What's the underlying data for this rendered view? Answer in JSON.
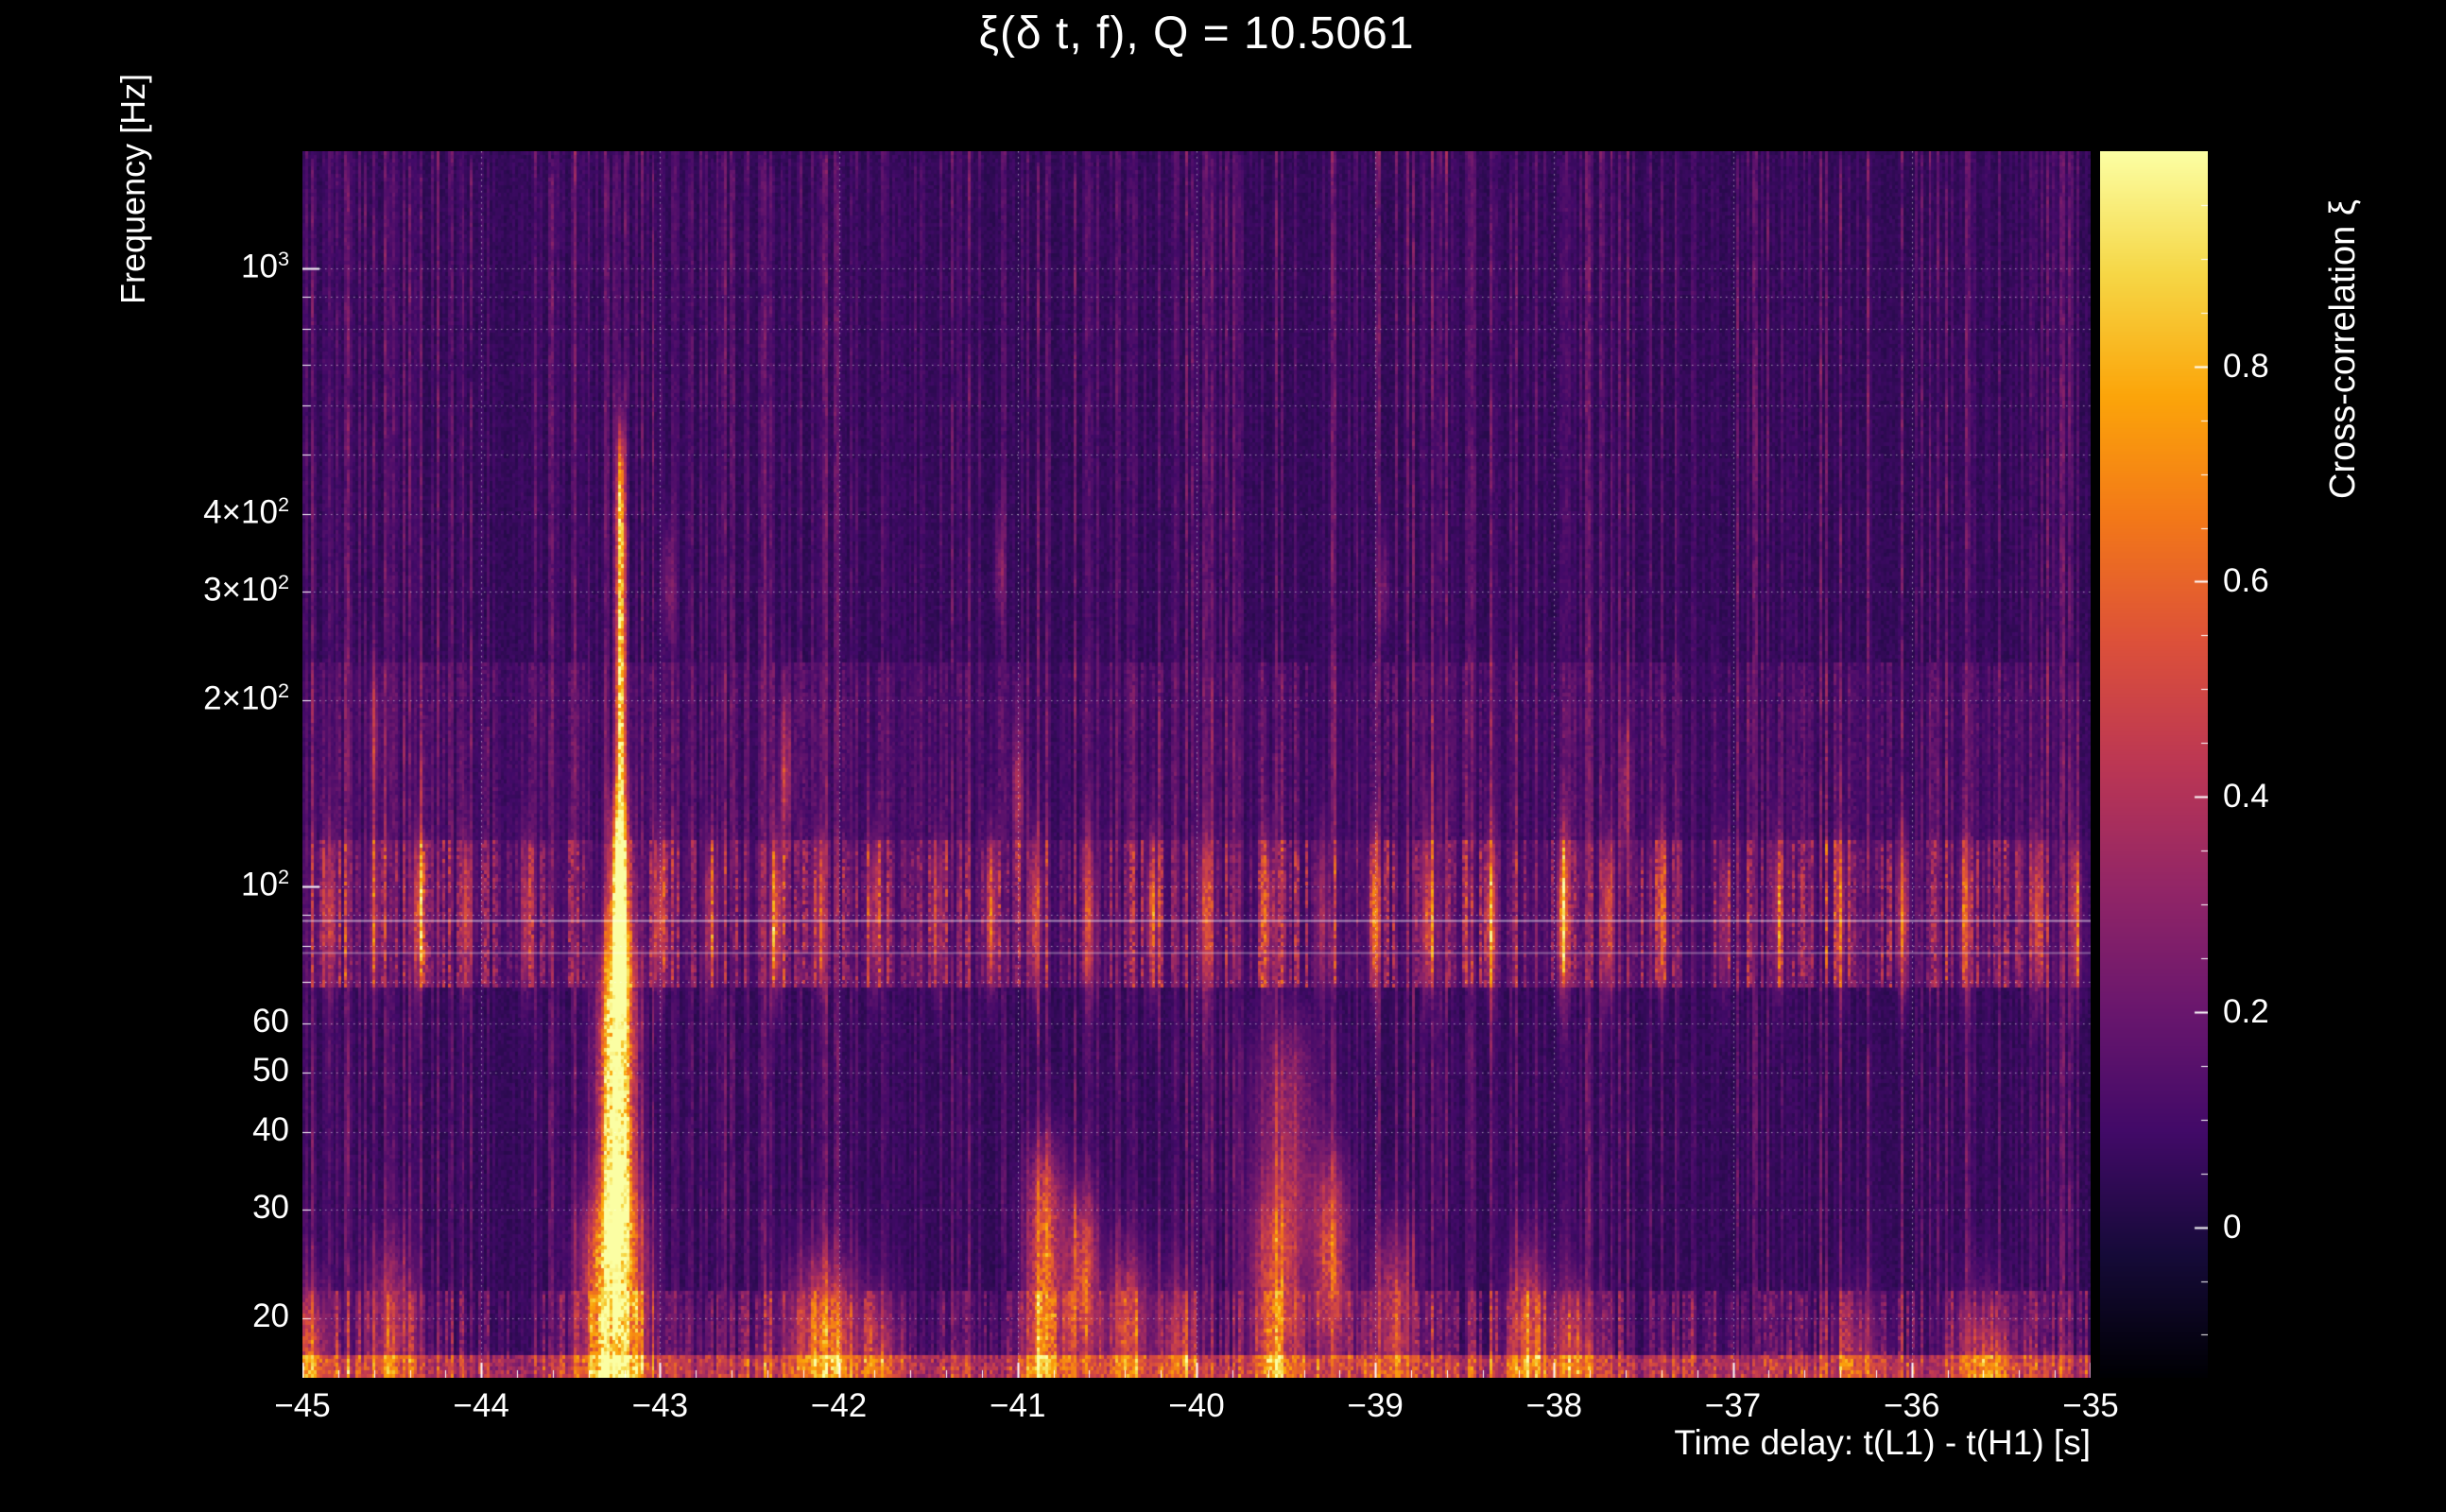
{
  "colors": {
    "background": "#000000",
    "text": "#ffffff",
    "grid": "#ffffff"
  },
  "chart_data": {
    "type": "heatmap",
    "title": "ξ(δ t, f), Q = 10.5061",
    "xlabel": "Time delay: t(L1) - t(H1) [s]",
    "ylabel": "Frequency [Hz]",
    "colorbar_label": "Cross-correlation ξ",
    "x_range": [
      -45,
      -35
    ],
    "y_range_hz": [
      16,
      1550
    ],
    "y_scale": "log",
    "value_range": [
      -0.14,
      1.0
    ],
    "x_ticks": [
      {
        "v": -45,
        "label": "−45"
      },
      {
        "v": -44,
        "label": "−44"
      },
      {
        "v": -43,
        "label": "−43"
      },
      {
        "v": -42,
        "label": "−42"
      },
      {
        "v": -41,
        "label": "−41"
      },
      {
        "v": -40,
        "label": "−40"
      },
      {
        "v": -39,
        "label": "−39"
      },
      {
        "v": -38,
        "label": "−38"
      },
      {
        "v": -37,
        "label": "−37"
      },
      {
        "v": -36,
        "label": "−36"
      },
      {
        "v": -35,
        "label": "−35"
      }
    ],
    "y_ticks": [
      {
        "f": 1000,
        "base": "10",
        "exp": "3"
      },
      {
        "f": 400,
        "base": "4×10",
        "exp": "2"
      },
      {
        "f": 300,
        "base": "3×10",
        "exp": "2"
      },
      {
        "f": 200,
        "base": "2×10",
        "exp": "2"
      },
      {
        "f": 100,
        "base": "10",
        "exp": "2"
      },
      {
        "f": 60,
        "base": "60"
      },
      {
        "f": 50,
        "base": "50"
      },
      {
        "f": 40,
        "base": "40"
      },
      {
        "f": 30,
        "base": "30"
      },
      {
        "f": 20,
        "base": "20"
      }
    ],
    "y_minor_ticks_hz": [
      20,
      30,
      40,
      50,
      60,
      70,
      80,
      90,
      200,
      300,
      400,
      500,
      600,
      700,
      800,
      900
    ],
    "grid_x": [
      -44,
      -43,
      -42,
      -41,
      -40,
      -39,
      -38,
      -37,
      -36
    ],
    "grid_y_hz": [
      20,
      30,
      40,
      50,
      60,
      70,
      80,
      90,
      100,
      200,
      300,
      400,
      500,
      600,
      700,
      800,
      900,
      1000
    ],
    "colorbar_ticks": [
      {
        "v": 0,
        "label": "0"
      },
      {
        "v": 0.2,
        "label": "0.2"
      },
      {
        "v": 0.4,
        "label": "0.4"
      },
      {
        "v": 0.6,
        "label": "0.6"
      },
      {
        "v": 0.8,
        "label": "0.8"
      }
    ],
    "spectral_lines_hz": [
      {
        "f": 88,
        "opacity": 0.5
      },
      {
        "f": 78,
        "opacity": 0.32
      }
    ],
    "colormap_stops": [
      [
        0,
        0,
        4
      ],
      [
        22,
        11,
        57
      ],
      [
        66,
        10,
        104
      ],
      [
        106,
        23,
        110
      ],
      [
        147,
        38,
        103
      ],
      [
        188,
        55,
        84
      ],
      [
        221,
        81,
        58
      ],
      [
        243,
        120,
        25
      ],
      [
        252,
        165,
        10
      ],
      [
        246,
        215,
        70
      ],
      [
        252,
        255,
        164
      ]
    ],
    "hotspots": [
      {
        "t": -43.22,
        "f1": 125,
        "f2": 480,
        "w": 0.016,
        "amp": 0.85
      },
      {
        "t": -43.22,
        "f1": 430,
        "f2": 530,
        "w": 0.014,
        "amp": 0.35
      },
      {
        "t": -43.23,
        "f1": 72,
        "f2": 130,
        "w": 0.035,
        "amp": 1.0
      },
      {
        "t": -43.24,
        "f1": 28,
        "f2": 76,
        "w": 0.065,
        "amp": 1.05
      },
      {
        "t": -43.26,
        "f1": 15,
        "f2": 30,
        "w": 0.11,
        "amp": 0.9
      },
      {
        "t": -42.95,
        "f1": 280,
        "f2": 335,
        "w": 0.02,
        "amp": 0.4
      },
      {
        "t": -41.1,
        "f1": 300,
        "f2": 355,
        "w": 0.02,
        "amp": 0.35
      },
      {
        "t": -38.95,
        "f1": 285,
        "f2": 330,
        "w": 0.02,
        "amp": 0.35
      },
      {
        "t": -44.6,
        "f1": 150,
        "f2": 205,
        "w": 0.02,
        "amp": 0.3
      },
      {
        "t": -42.3,
        "f1": 130,
        "f2": 185,
        "w": 0.025,
        "amp": 0.35
      },
      {
        "t": -41.0,
        "f1": 120,
        "f2": 165,
        "w": 0.02,
        "amp": 0.35
      },
      {
        "t": -37.6,
        "f1": 120,
        "f2": 170,
        "w": 0.02,
        "amp": 0.3
      },
      {
        "t": -44.97,
        "f1": 15,
        "f2": 21,
        "w": 0.08,
        "amp": 0.5
      },
      {
        "t": -44.5,
        "f1": 15,
        "f2": 24,
        "w": 0.1,
        "amp": 0.35
      },
      {
        "t": -42.08,
        "f1": 15,
        "f2": 23,
        "w": 0.13,
        "amp": 0.6
      },
      {
        "t": -41.75,
        "f1": 15,
        "f2": 20,
        "w": 0.08,
        "amp": 0.3
      },
      {
        "t": -40.85,
        "f1": 15,
        "f2": 36,
        "w": 0.07,
        "amp": 0.55
      },
      {
        "t": -40.64,
        "f1": 17,
        "f2": 30,
        "w": 0.06,
        "amp": 0.5
      },
      {
        "t": -40.38,
        "f1": 15,
        "f2": 24,
        "w": 0.08,
        "amp": 0.45
      },
      {
        "t": -40.1,
        "f1": 15,
        "f2": 22,
        "w": 0.07,
        "amp": 0.35
      },
      {
        "t": -39.55,
        "f1": 15,
        "f2": 30,
        "w": 0.1,
        "amp": 0.5
      },
      {
        "t": -39.5,
        "f1": 28,
        "f2": 58,
        "w": 0.12,
        "amp": 0.28
      },
      {
        "t": -39.25,
        "f1": 18,
        "f2": 34,
        "w": 0.07,
        "amp": 0.45
      },
      {
        "t": -38.9,
        "f1": 15,
        "f2": 26,
        "w": 0.08,
        "amp": 0.4
      },
      {
        "t": -38.15,
        "f1": 15,
        "f2": 24,
        "w": 0.07,
        "amp": 0.5
      },
      {
        "t": -37.9,
        "f1": 15,
        "f2": 21,
        "w": 0.08,
        "amp": 0.4
      },
      {
        "t": -36.3,
        "f1": 15,
        "f2": 20,
        "w": 0.09,
        "amp": 0.3
      },
      {
        "t": -35.6,
        "f1": 14,
        "f2": 20,
        "w": 0.1,
        "amp": 0.45
      }
    ],
    "band_speckles": {
      "f1": 72,
      "f2": 112,
      "w": 0.022,
      "points": [
        [
          -44.85,
          0.38
        ],
        [
          -44.6,
          0.3
        ],
        [
          -44.35,
          0.46
        ],
        [
          -44.08,
          0.3
        ],
        [
          -43.75,
          0.32
        ],
        [
          -43.0,
          0.42
        ],
        [
          -42.72,
          0.35
        ],
        [
          -42.35,
          0.5
        ],
        [
          -42.1,
          0.3
        ],
        [
          -41.8,
          0.36
        ],
        [
          -41.45,
          0.3
        ],
        [
          -41.15,
          0.46
        ],
        [
          -40.9,
          0.5
        ],
        [
          -40.6,
          0.36
        ],
        [
          -40.25,
          0.4
        ],
        [
          -39.95,
          0.46
        ],
        [
          -39.6,
          0.36
        ],
        [
          -39.3,
          0.3
        ],
        [
          -39.0,
          0.46
        ],
        [
          -38.7,
          0.36
        ],
        [
          -38.35,
          0.4
        ],
        [
          -37.95,
          0.62
        ],
        [
          -37.7,
          0.46
        ],
        [
          -37.4,
          0.36
        ],
        [
          -37.05,
          0.3
        ],
        [
          -36.75,
          0.36
        ],
        [
          -36.4,
          0.3
        ],
        [
          -36.05,
          0.46
        ],
        [
          -35.7,
          0.36
        ],
        [
          -35.3,
          0.42
        ],
        [
          -35.08,
          0.32
        ]
      ]
    }
  }
}
